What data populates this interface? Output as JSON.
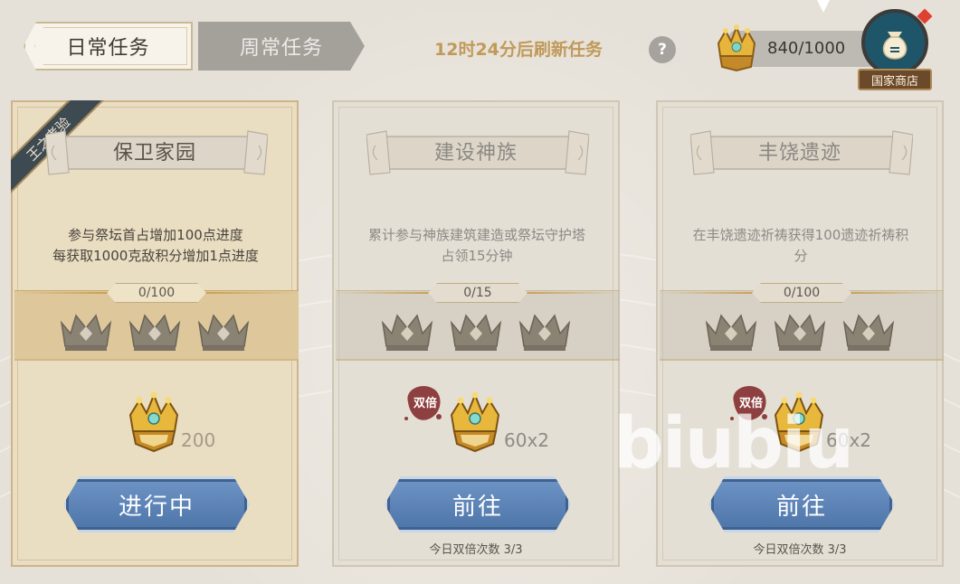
{
  "tabs": {
    "daily": "日常任务",
    "weekly": "周常任务"
  },
  "header": {
    "refresh_text": "12时24分后刷新任务",
    "help_glyph": "?",
    "points": "840/1000",
    "shop_label": "国家商店"
  },
  "cards": [
    {
      "ribbon": "王之考验",
      "title": "保卫家园",
      "description": "参与祭坛首占增加100点进度\n每获取1000克敌积分增加1点进度",
      "progress": "0/100",
      "reward": "200",
      "button": "进行中"
    },
    {
      "title": "建设神族",
      "description": "累计参与神族建筑建造或祭坛守护塔\n占领15分钟",
      "progress": "0/15",
      "double_badge": "双倍",
      "reward": "60x2",
      "button": "前往",
      "double_count": "今日双倍次数 3/3"
    },
    {
      "title": "丰饶遗迹",
      "description": "在丰饶遗迹祈祷获得100遗迹祈祷积\n分",
      "progress": "0/100",
      "double_badge": "双倍",
      "reward": "60x2",
      "button": "前往",
      "double_count": "今日双倍次数 3/3"
    }
  ],
  "watermark": "biubiu",
  "colors": {
    "gold_text": "#c09a5a",
    "button_blue": "#5a80b3",
    "active_card": "#e9ddc2",
    "inactive_card": "#e4dfd5",
    "double_badge": "#8b3c3c"
  },
  "icons": {
    "currency": "gold-crown-icon",
    "progress": "crown-outline-icon",
    "shop": "money-bag-icon",
    "help": "question-icon"
  }
}
